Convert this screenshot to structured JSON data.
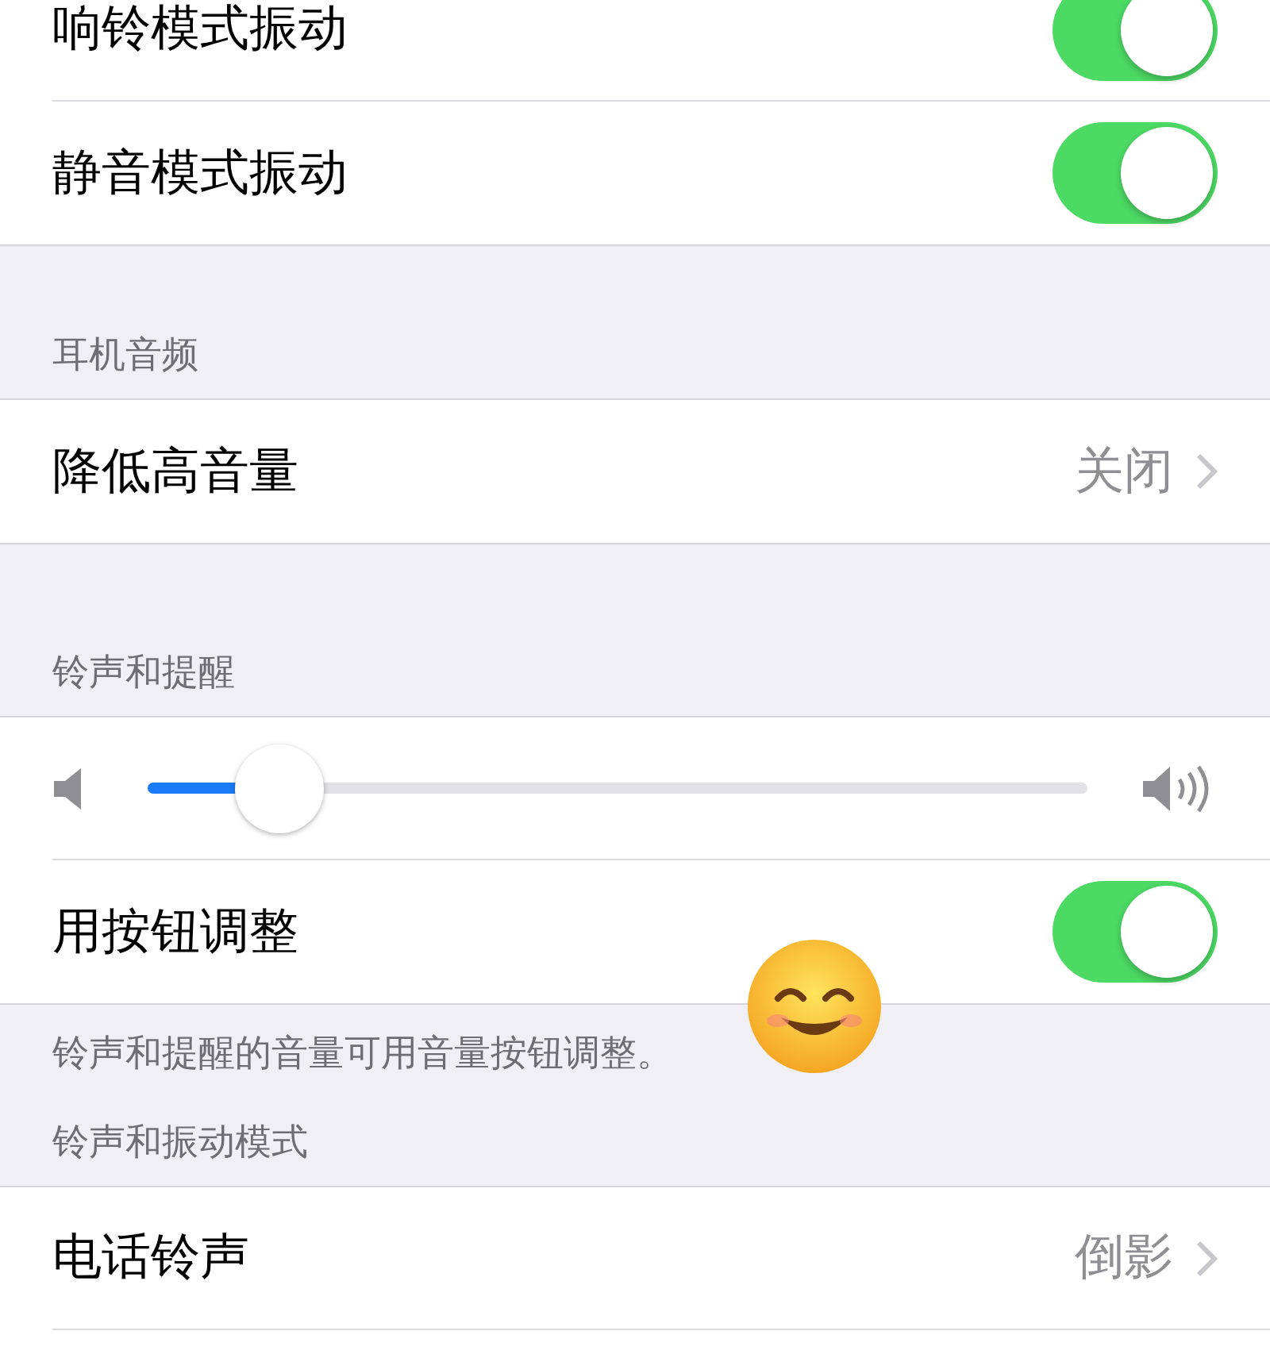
{
  "groups": [
    {
      "rows": [
        {
          "kind": "toggle",
          "label": "响铃模式振动",
          "on": true
        },
        {
          "kind": "toggle",
          "label": "静音模式振动",
          "on": true
        }
      ]
    },
    {
      "header": "耳机音频",
      "rows": [
        {
          "kind": "link",
          "label": "降低高音量",
          "value": "关闭"
        }
      ]
    },
    {
      "header": "铃声和提醒",
      "rows": [
        {
          "kind": "slider",
          "level": 0.14
        },
        {
          "kind": "toggle",
          "label": "用按钮调整",
          "on": true
        }
      ],
      "footer": "铃声和提醒的音量可用音量按钮调整。"
    },
    {
      "header": "铃声和振动模式",
      "rows": [
        {
          "kind": "link",
          "label": "电话铃声",
          "value": "倒影"
        },
        {
          "kind": "blank"
        }
      ]
    }
  ]
}
